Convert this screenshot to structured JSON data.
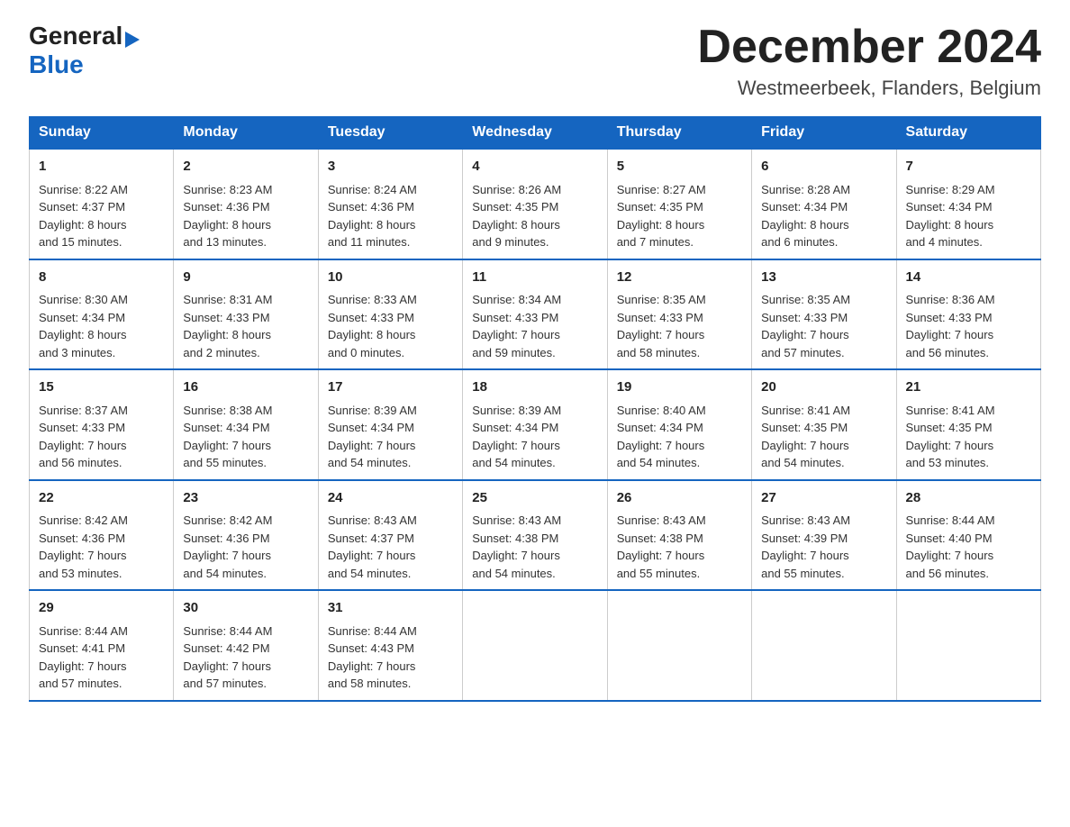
{
  "header": {
    "logo": {
      "general": "General",
      "blue": "Blue",
      "arrow": "▶"
    },
    "month_title": "December 2024",
    "location": "Westmeerbeek, Flanders, Belgium"
  },
  "calendar": {
    "days_of_week": [
      "Sunday",
      "Monday",
      "Tuesday",
      "Wednesday",
      "Thursday",
      "Friday",
      "Saturday"
    ],
    "weeks": [
      [
        {
          "day": "1",
          "sunrise": "8:22 AM",
          "sunset": "4:37 PM",
          "daylight": "8 hours and 15 minutes."
        },
        {
          "day": "2",
          "sunrise": "8:23 AM",
          "sunset": "4:36 PM",
          "daylight": "8 hours and 13 minutes."
        },
        {
          "day": "3",
          "sunrise": "8:24 AM",
          "sunset": "4:36 PM",
          "daylight": "8 hours and 11 minutes."
        },
        {
          "day": "4",
          "sunrise": "8:26 AM",
          "sunset": "4:35 PM",
          "daylight": "8 hours and 9 minutes."
        },
        {
          "day": "5",
          "sunrise": "8:27 AM",
          "sunset": "4:35 PM",
          "daylight": "8 hours and 7 minutes."
        },
        {
          "day": "6",
          "sunrise": "8:28 AM",
          "sunset": "4:34 PM",
          "daylight": "8 hours and 6 minutes."
        },
        {
          "day": "7",
          "sunrise": "8:29 AM",
          "sunset": "4:34 PM",
          "daylight": "8 hours and 4 minutes."
        }
      ],
      [
        {
          "day": "8",
          "sunrise": "8:30 AM",
          "sunset": "4:34 PM",
          "daylight": "8 hours and 3 minutes."
        },
        {
          "day": "9",
          "sunrise": "8:31 AM",
          "sunset": "4:33 PM",
          "daylight": "8 hours and 2 minutes."
        },
        {
          "day": "10",
          "sunrise": "8:33 AM",
          "sunset": "4:33 PM",
          "daylight": "8 hours and 0 minutes."
        },
        {
          "day": "11",
          "sunrise": "8:34 AM",
          "sunset": "4:33 PM",
          "daylight": "7 hours and 59 minutes."
        },
        {
          "day": "12",
          "sunrise": "8:35 AM",
          "sunset": "4:33 PM",
          "daylight": "7 hours and 58 minutes."
        },
        {
          "day": "13",
          "sunrise": "8:35 AM",
          "sunset": "4:33 PM",
          "daylight": "7 hours and 57 minutes."
        },
        {
          "day": "14",
          "sunrise": "8:36 AM",
          "sunset": "4:33 PM",
          "daylight": "7 hours and 56 minutes."
        }
      ],
      [
        {
          "day": "15",
          "sunrise": "8:37 AM",
          "sunset": "4:33 PM",
          "daylight": "7 hours and 56 minutes."
        },
        {
          "day": "16",
          "sunrise": "8:38 AM",
          "sunset": "4:34 PM",
          "daylight": "7 hours and 55 minutes."
        },
        {
          "day": "17",
          "sunrise": "8:39 AM",
          "sunset": "4:34 PM",
          "daylight": "7 hours and 54 minutes."
        },
        {
          "day": "18",
          "sunrise": "8:39 AM",
          "sunset": "4:34 PM",
          "daylight": "7 hours and 54 minutes."
        },
        {
          "day": "19",
          "sunrise": "8:40 AM",
          "sunset": "4:34 PM",
          "daylight": "7 hours and 54 minutes."
        },
        {
          "day": "20",
          "sunrise": "8:41 AM",
          "sunset": "4:35 PM",
          "daylight": "7 hours and 54 minutes."
        },
        {
          "day": "21",
          "sunrise": "8:41 AM",
          "sunset": "4:35 PM",
          "daylight": "7 hours and 53 minutes."
        }
      ],
      [
        {
          "day": "22",
          "sunrise": "8:42 AM",
          "sunset": "4:36 PM",
          "daylight": "7 hours and 53 minutes."
        },
        {
          "day": "23",
          "sunrise": "8:42 AM",
          "sunset": "4:36 PM",
          "daylight": "7 hours and 54 minutes."
        },
        {
          "day": "24",
          "sunrise": "8:43 AM",
          "sunset": "4:37 PM",
          "daylight": "7 hours and 54 minutes."
        },
        {
          "day": "25",
          "sunrise": "8:43 AM",
          "sunset": "4:38 PM",
          "daylight": "7 hours and 54 minutes."
        },
        {
          "day": "26",
          "sunrise": "8:43 AM",
          "sunset": "4:38 PM",
          "daylight": "7 hours and 55 minutes."
        },
        {
          "day": "27",
          "sunrise": "8:43 AM",
          "sunset": "4:39 PM",
          "daylight": "7 hours and 55 minutes."
        },
        {
          "day": "28",
          "sunrise": "8:44 AM",
          "sunset": "4:40 PM",
          "daylight": "7 hours and 56 minutes."
        }
      ],
      [
        {
          "day": "29",
          "sunrise": "8:44 AM",
          "sunset": "4:41 PM",
          "daylight": "7 hours and 57 minutes."
        },
        {
          "day": "30",
          "sunrise": "8:44 AM",
          "sunset": "4:42 PM",
          "daylight": "7 hours and 57 minutes."
        },
        {
          "day": "31",
          "sunrise": "8:44 AM",
          "sunset": "4:43 PM",
          "daylight": "7 hours and 58 minutes."
        },
        null,
        null,
        null,
        null
      ]
    ],
    "labels": {
      "sunrise": "Sunrise:",
      "sunset": "Sunset:",
      "daylight": "Daylight:"
    }
  }
}
